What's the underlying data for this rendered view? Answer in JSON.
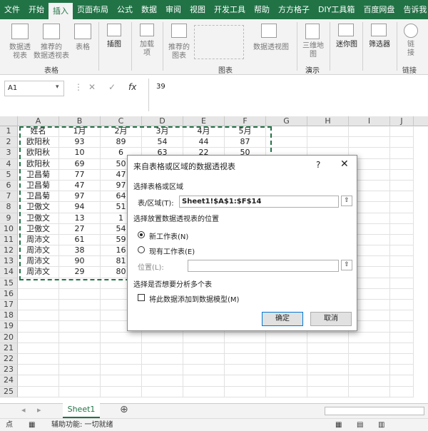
{
  "ribbon_tabs": [
    "文件",
    "开始",
    "插入",
    "页面布局",
    "公式",
    "数据",
    "审阅",
    "视图",
    "开发工具",
    "帮助",
    "方方格子",
    "DIY工具箱",
    "百度网盘"
  ],
  "active_tab": "插入",
  "tell_me": "告诉我",
  "ribbon": {
    "pivot": "数据透\n视表",
    "recommended_pivot": "推荐的\n数据透视表",
    "table": "表格",
    "group_tables": "表格",
    "illustrations": "插图",
    "addins": "加载\n项",
    "recommended_charts": "推荐的\n图表",
    "pivot_chart": "数据透视图",
    "group_charts": "图表",
    "map_3d": "三维地\n图",
    "group_tours": "演示",
    "sparklines": "迷你图",
    "slicer": "筛选器",
    "link": "链\n接",
    "group_links": "链接"
  },
  "namebox": "A1",
  "formula_value": "39",
  "columns": [
    "A",
    "B",
    "C",
    "D",
    "E",
    "F",
    "G",
    "H",
    "I",
    "J"
  ],
  "rows": [
    "1",
    "2",
    "3",
    "4",
    "5",
    "6",
    "7",
    "8",
    "9",
    "10",
    "11",
    "12",
    "13",
    "14",
    "15",
    "16",
    "17",
    "18",
    "19",
    "20",
    "21",
    "22",
    "23",
    "24",
    "25"
  ],
  "table": [
    [
      "姓名",
      "1月",
      "2月",
      "3月",
      "4月",
      "5月"
    ],
    [
      "欧阳秋",
      "93",
      "89",
      "54",
      "44",
      "87"
    ],
    [
      "欧阳秋",
      "10",
      "6",
      "63",
      "22",
      "50"
    ],
    [
      "欧阳秋",
      "69",
      "50",
      "",
      "",
      ""
    ],
    [
      "卫昌菊",
      "77",
      "47",
      "",
      "",
      ""
    ],
    [
      "卫昌菊",
      "47",
      "97",
      "",
      "",
      ""
    ],
    [
      "卫昌菊",
      "97",
      "64",
      "",
      "",
      ""
    ],
    [
      "卫傲文",
      "94",
      "51",
      "",
      "",
      ""
    ],
    [
      "卫傲文",
      "13",
      "1",
      "",
      "",
      ""
    ],
    [
      "卫傲文",
      "27",
      "54",
      "",
      "",
      ""
    ],
    [
      "周沛文",
      "61",
      "59",
      "",
      "",
      ""
    ],
    [
      "周沛文",
      "38",
      "16",
      "",
      "",
      ""
    ],
    [
      "周沛文",
      "90",
      "81",
      "",
      "",
      ""
    ],
    [
      "周沛文",
      "29",
      "80",
      "",
      "",
      ""
    ]
  ],
  "sheet_tab": "Sheet1",
  "status": {
    "mode": "点",
    "accessibility": "辅助功能: 一切就绪"
  },
  "dialog": {
    "title": "来自表格或区域的数据透视表",
    "help": "?",
    "close": "✕",
    "section1": "选择表格或区域",
    "range_label": "表/区域(T):",
    "range_value": "Sheet1!$A$1:$F$14",
    "section2": "选择放置数据透视表的位置",
    "opt_new": "新工作表(N)",
    "opt_existing": "现有工作表(E)",
    "location_label": "位置(L):",
    "section3": "选择是否想要分析多个表",
    "add_model": "将此数据添加到数据模型(M)",
    "ok": "确定",
    "cancel": "取消"
  }
}
